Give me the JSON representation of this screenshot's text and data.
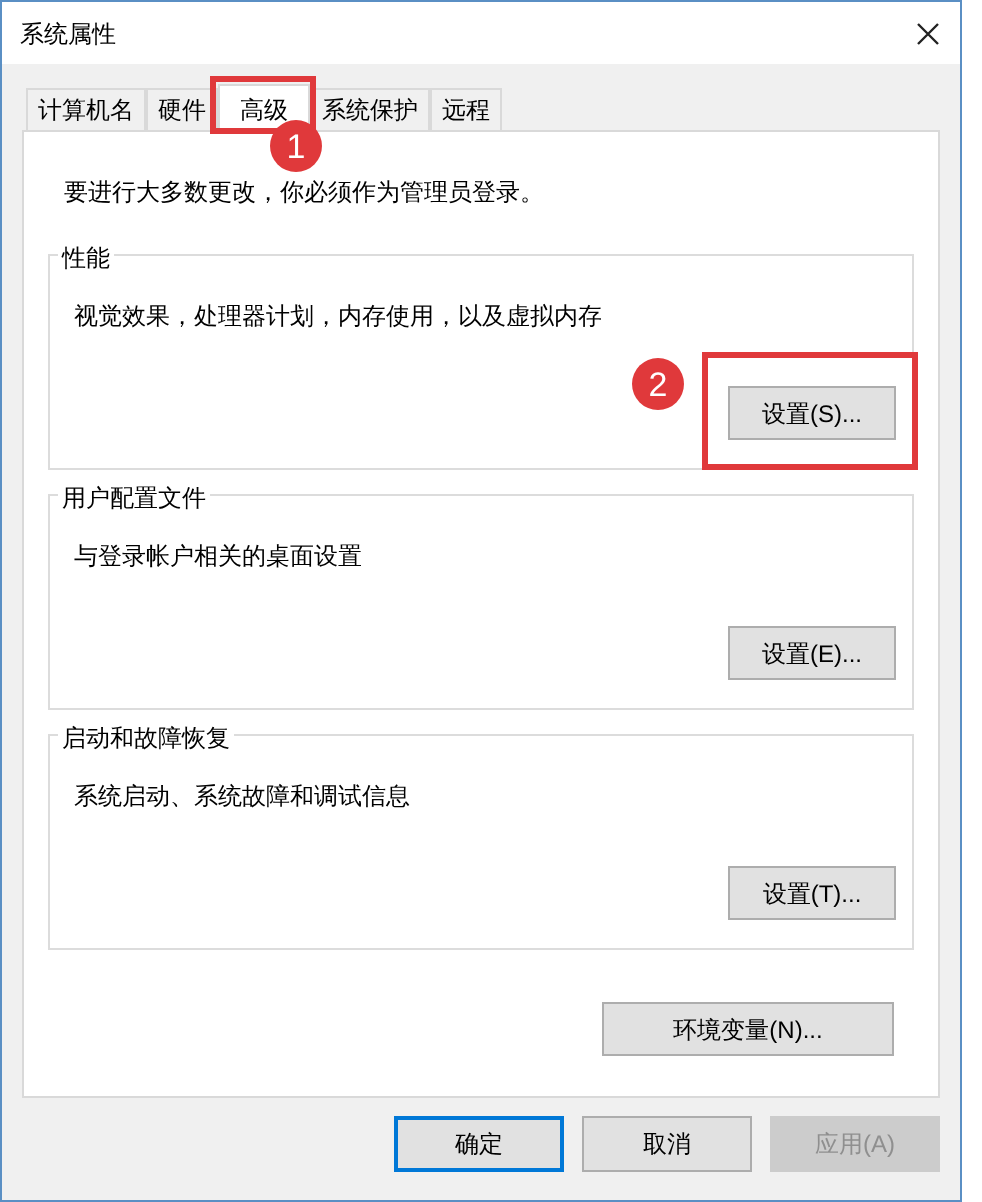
{
  "window": {
    "title": "系统属性"
  },
  "tabs": [
    {
      "label": "计算机名",
      "selected": false
    },
    {
      "label": "硬件",
      "selected": false
    },
    {
      "label": "高级",
      "selected": true,
      "annotation": "1"
    },
    {
      "label": "系统保护",
      "selected": false
    },
    {
      "label": "远程",
      "selected": false
    }
  ],
  "notice": "要进行大多数更改，你必须作为管理员登录。",
  "groups": [
    {
      "title": "性能",
      "description": "视觉效果，处理器计划，内存使用，以及虚拟内存",
      "button": "设置(S)...",
      "annotation": "2"
    },
    {
      "title": "用户配置文件",
      "description": "与登录帐户相关的桌面设置",
      "button": "设置(E)..."
    },
    {
      "title": "启动和故障恢复",
      "description": "系统启动、系统故障和调试信息",
      "button": "设置(T)..."
    }
  ],
  "env_button": "环境变量(N)...",
  "buttons": [
    {
      "label": "确定",
      "default": true,
      "disabled": false
    },
    {
      "label": "取消",
      "default": false,
      "disabled": false
    },
    {
      "label": "应用(A)",
      "default": false,
      "disabled": true
    }
  ]
}
